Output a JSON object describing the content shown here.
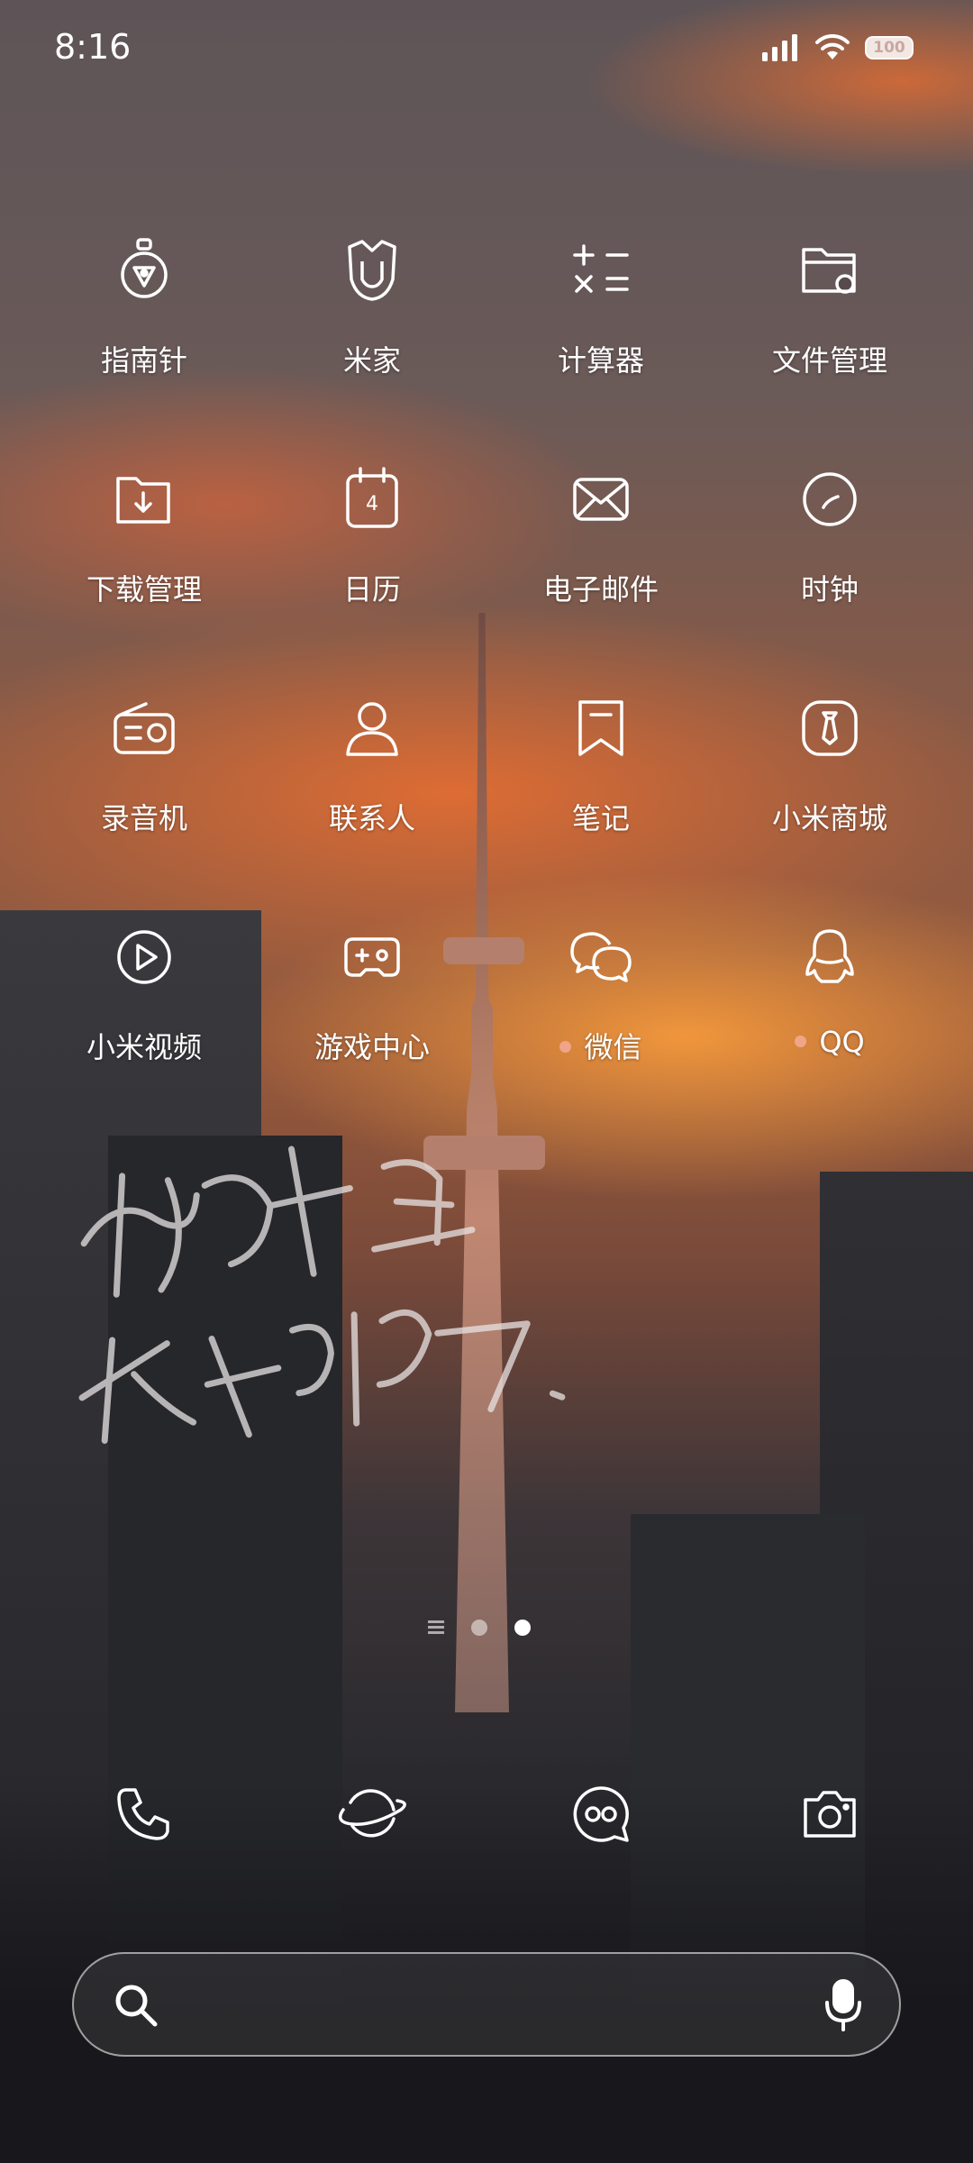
{
  "status_bar": {
    "time": "8:16",
    "battery": "100"
  },
  "apps": [
    {
      "label": "指南针",
      "icon": "compass-icon"
    },
    {
      "label": "米家",
      "icon": "mi-home-icon"
    },
    {
      "label": "计算器",
      "icon": "calculator-icon"
    },
    {
      "label": "文件管理",
      "icon": "file-manager-icon"
    },
    {
      "label": "下载管理",
      "icon": "downloads-icon"
    },
    {
      "label": "日历",
      "icon": "calendar-icon",
      "calendar_day": "4"
    },
    {
      "label": "电子邮件",
      "icon": "email-icon"
    },
    {
      "label": "时钟",
      "icon": "clock-icon"
    },
    {
      "label": "录音机",
      "icon": "recorder-icon"
    },
    {
      "label": "联系人",
      "icon": "contacts-icon"
    },
    {
      "label": "笔记",
      "icon": "notes-icon"
    },
    {
      "label": "小米商城",
      "icon": "mi-store-icon"
    },
    {
      "label": "小米视频",
      "icon": "mi-video-icon"
    },
    {
      "label": "游戏中心",
      "icon": "game-center-icon"
    },
    {
      "label": "微信",
      "icon": "wechat-icon",
      "new_dot": true
    },
    {
      "label": "QQ",
      "icon": "qq-icon",
      "new_dot": true
    }
  ],
  "dock": [
    "phone-icon",
    "browser-icon",
    "messages-icon",
    "camera-icon"
  ],
  "pager": {
    "pages": 2,
    "active": 2
  },
  "search": {
    "placeholder": ""
  },
  "colors": {
    "new_dot": "#f0a58a"
  }
}
